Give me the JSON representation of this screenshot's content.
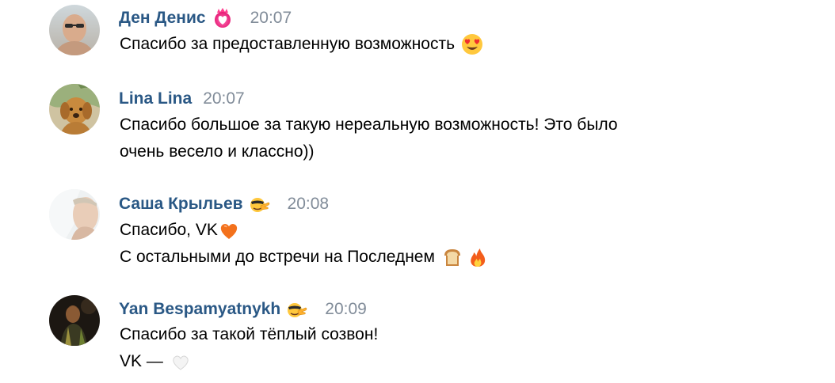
{
  "messages": [
    {
      "author": "Ден Денис",
      "time": "20:07",
      "badge_icon": "heart-flame-badge-icon",
      "lines": [
        {
          "text": "Спасибо за предоставленную возможность",
          "emojis": [
            "heart-eyes-emoji"
          ]
        }
      ]
    },
    {
      "author": "Lina Lina",
      "time": "20:07",
      "lines": [
        {
          "text": "Спасибо большое за такую нереальную возможность! Это было"
        },
        {
          "text": "очень весело и классно))"
        }
      ]
    },
    {
      "author": "Саша Крыльев",
      "time": "20:08",
      "badge_icon": "cool-hand-badge-icon",
      "lines": [
        {
          "text": "Спасибо, VK",
          "emojis": [
            "orange-heart-emoji"
          ]
        },
        {
          "text": "С остальными до встречи на Последнем",
          "emojis": [
            "bread-emoji",
            "fire-emoji"
          ]
        }
      ]
    },
    {
      "author": "Yan Bespamyatnykh",
      "time": "20:09",
      "badge_icon": "cool-hand-badge-icon",
      "lines": [
        {
          "text": "Спасибо за такой тёплый созвон!"
        },
        {
          "text": "VK —",
          "emojis": [
            "white-heart-emoji"
          ]
        }
      ]
    }
  ],
  "colors": {
    "author": "#2a5885",
    "time": "#818c99",
    "text": "#000000",
    "background": "#ffffff"
  }
}
